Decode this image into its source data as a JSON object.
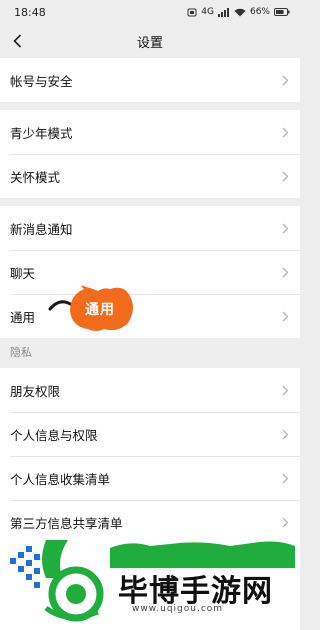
{
  "status": {
    "time": "18:48",
    "battery": "66%",
    "network": "4G"
  },
  "nav": {
    "title": "设置",
    "back_icon": "chevron-left-icon"
  },
  "groups": [
    {
      "items": [
        "帐号与安全"
      ]
    },
    {
      "items": [
        "青少年模式",
        "关怀模式"
      ]
    },
    {
      "items": [
        "新消息通知",
        "聊天",
        "通用"
      ]
    }
  ],
  "privacy": {
    "label": "隐私",
    "items": [
      "朋友权限",
      "个人信息与权限",
      "个人信息收集清单",
      "第三方信息共享清单"
    ]
  },
  "annotation": {
    "label": "通用",
    "color": "#f26a1b"
  },
  "watermark": {
    "brand": "毕博手游网",
    "url": "www.uqigou.com",
    "green": "#1fae3b",
    "blue": "#1f6fd6"
  }
}
